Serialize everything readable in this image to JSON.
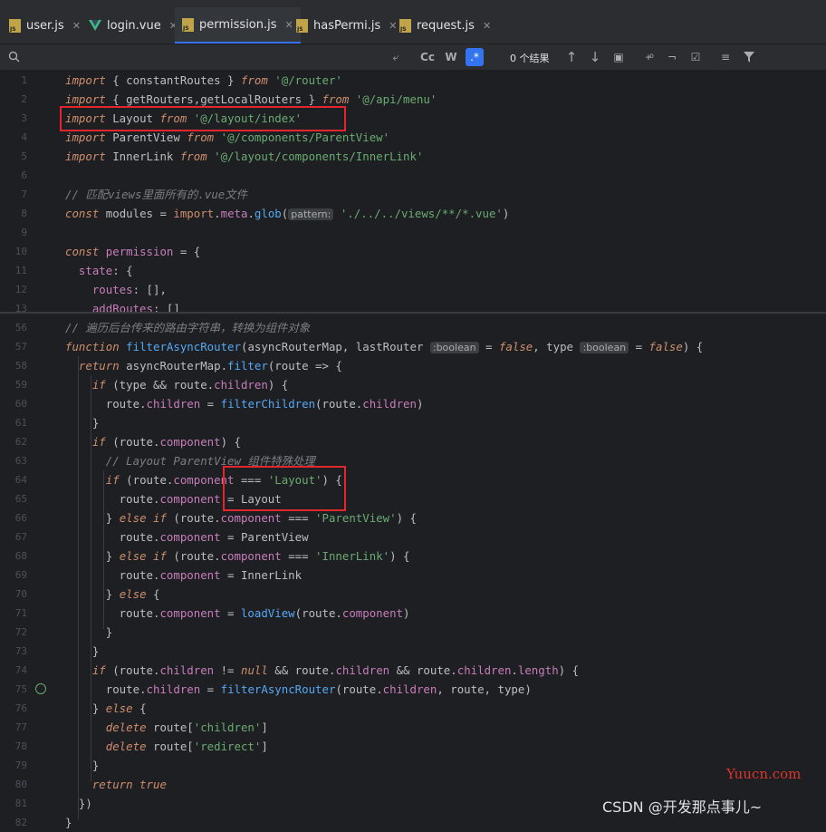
{
  "tabs": [
    {
      "label": "user.js",
      "icon": "js-file-icon"
    },
    {
      "label": "login.vue",
      "icon": "vue-file-icon"
    },
    {
      "label": "permission.js",
      "icon": "js-file-icon",
      "active": true
    },
    {
      "label": "hasPermi.js",
      "icon": "js-file-icon"
    },
    {
      "label": "request.js",
      "icon": "js-file-icon"
    }
  ],
  "search": {
    "match_case": "Cc",
    "words": "W",
    "regex": ".*",
    "results": "0 个结果"
  },
  "sticky_lines": [
    {
      "n": "1",
      "segs": [
        [
          "kwi",
          "import"
        ],
        [
          "t",
          " { constantRoutes } "
        ],
        [
          "kwi",
          "from"
        ],
        [
          "t",
          " "
        ],
        [
          "str",
          "'@/router'"
        ]
      ]
    },
    {
      "n": "2",
      "segs": [
        [
          "kwi",
          "import"
        ],
        [
          "t",
          " { getRouters,getLocalRouters } "
        ],
        [
          "kwi",
          "from"
        ],
        [
          "t",
          " "
        ],
        [
          "str",
          "'@/api/menu'"
        ]
      ]
    },
    {
      "n": "3",
      "segs": [
        [
          "kwi",
          "import"
        ],
        [
          "t",
          " Layout "
        ],
        [
          "kwi",
          "from"
        ],
        [
          "t",
          " "
        ],
        [
          "str",
          "'@/layout/index'"
        ]
      ]
    },
    {
      "n": "4",
      "segs": [
        [
          "kwi",
          "import"
        ],
        [
          "t",
          " ParentView "
        ],
        [
          "kwi",
          "from"
        ],
        [
          "t",
          " "
        ],
        [
          "str",
          "'@/components/ParentView'"
        ]
      ]
    },
    {
      "n": "5",
      "segs": [
        [
          "kwi",
          "import"
        ],
        [
          "t",
          " InnerLink "
        ],
        [
          "kwi",
          "from"
        ],
        [
          "t",
          " "
        ],
        [
          "str",
          "'@/layout/components/InnerLink'"
        ]
      ]
    },
    {
      "n": "6",
      "segs": []
    },
    {
      "n": "7",
      "segs": [
        [
          "cm",
          "// 匹配views里面所有的.vue文件"
        ]
      ]
    },
    {
      "n": "8",
      "segs": [
        [
          "kwi",
          "const"
        ],
        [
          "t",
          " modules = "
        ],
        [
          "kw",
          "import"
        ],
        [
          "t",
          "."
        ],
        [
          "prop",
          "meta"
        ],
        [
          "t",
          "."
        ],
        [
          "fn",
          "glob"
        ],
        [
          "t",
          "("
        ],
        [
          "hint",
          "pattern:"
        ],
        [
          "t",
          " "
        ],
        [
          "str",
          "'./../../views/**/*.vue'"
        ],
        [
          "t",
          ")"
        ]
      ]
    },
    {
      "n": "9",
      "segs": []
    },
    {
      "n": "10",
      "segs": [
        [
          "kwi",
          "const"
        ],
        [
          "prop",
          " permission"
        ],
        [
          "t",
          " = {"
        ]
      ]
    },
    {
      "n": "11",
      "segs": [
        [
          "t",
          "  "
        ],
        [
          "prop",
          "state"
        ],
        [
          "t",
          ": {"
        ]
      ]
    },
    {
      "n": "12",
      "segs": [
        [
          "t",
          "    "
        ],
        [
          "prop",
          "routes"
        ],
        [
          "t",
          ": [],"
        ]
      ]
    },
    {
      "n": "13",
      "segs": [
        [
          "t",
          "    "
        ],
        [
          "prop",
          "addRoutes"
        ],
        [
          "t",
          ": []"
        ]
      ]
    }
  ],
  "code_lines": [
    {
      "n": "56",
      "segs": [
        [
          "cm",
          "// 遍历后台传来的路由字符串，转换为组件对象"
        ]
      ]
    },
    {
      "n": "57",
      "segs": [
        [
          "kwi",
          "function"
        ],
        [
          "t",
          " "
        ],
        [
          "fn",
          "filterAsyncRouter"
        ],
        [
          "t",
          "(asyncRouterMap, lastRouter "
        ],
        [
          "hint",
          ":boolean"
        ],
        [
          "t",
          " = "
        ],
        [
          "kwi",
          "false"
        ],
        [
          "t",
          ", type "
        ],
        [
          "hint",
          ":boolean"
        ],
        [
          "t",
          " = "
        ],
        [
          "kwi",
          "false"
        ],
        [
          "t",
          ") {"
        ]
      ]
    },
    {
      "n": "58",
      "segs": [
        [
          "t",
          "  "
        ],
        [
          "kwi",
          "return"
        ],
        [
          "t",
          " asyncRouterMap."
        ],
        [
          "fn",
          "filter"
        ],
        [
          "t",
          "(route => {"
        ]
      ]
    },
    {
      "n": "59",
      "segs": [
        [
          "t",
          "    "
        ],
        [
          "kwi",
          "if"
        ],
        [
          "t",
          " (type && route."
        ],
        [
          "prop",
          "children"
        ],
        [
          "t",
          ") {"
        ]
      ]
    },
    {
      "n": "60",
      "segs": [
        [
          "t",
          "      route."
        ],
        [
          "prop",
          "children"
        ],
        [
          "t",
          " = "
        ],
        [
          "fn",
          "filterChildren"
        ],
        [
          "t",
          "(route."
        ],
        [
          "prop",
          "children"
        ],
        [
          "t",
          ")"
        ]
      ]
    },
    {
      "n": "61",
      "segs": [
        [
          "t",
          "    }"
        ]
      ]
    },
    {
      "n": "62",
      "segs": [
        [
          "t",
          "    "
        ],
        [
          "kwi",
          "if"
        ],
        [
          "t",
          " (route."
        ],
        [
          "prop",
          "component"
        ],
        [
          "t",
          ") {"
        ]
      ]
    },
    {
      "n": "63",
      "segs": [
        [
          "t",
          "      "
        ],
        [
          "cm",
          "// Layout ParentView 组件特殊处理"
        ]
      ]
    },
    {
      "n": "64",
      "segs": [
        [
          "t",
          "      "
        ],
        [
          "kwi",
          "if"
        ],
        [
          "t",
          " (route."
        ],
        [
          "prop",
          "component"
        ],
        [
          "t",
          " === "
        ],
        [
          "str",
          "'Layout'"
        ],
        [
          "t",
          ") {"
        ]
      ]
    },
    {
      "n": "65",
      "segs": [
        [
          "t",
          "        route."
        ],
        [
          "prop",
          "component"
        ],
        [
          "t",
          " = Layout"
        ]
      ]
    },
    {
      "n": "66",
      "segs": [
        [
          "t",
          "      } "
        ],
        [
          "kwi",
          "else if"
        ],
        [
          "t",
          " (route."
        ],
        [
          "prop",
          "component"
        ],
        [
          "t",
          " === "
        ],
        [
          "str",
          "'ParentView'"
        ],
        [
          "t",
          ") {"
        ]
      ]
    },
    {
      "n": "67",
      "segs": [
        [
          "t",
          "        route."
        ],
        [
          "prop",
          "component"
        ],
        [
          "t",
          " = ParentView"
        ]
      ]
    },
    {
      "n": "68",
      "segs": [
        [
          "t",
          "      } "
        ],
        [
          "kwi",
          "else if"
        ],
        [
          "t",
          " (route."
        ],
        [
          "prop",
          "component"
        ],
        [
          "t",
          " === "
        ],
        [
          "str",
          "'InnerLink'"
        ],
        [
          "t",
          ") {"
        ]
      ]
    },
    {
      "n": "69",
      "segs": [
        [
          "t",
          "        route."
        ],
        [
          "prop",
          "component"
        ],
        [
          "t",
          " = InnerLink"
        ]
      ]
    },
    {
      "n": "70",
      "segs": [
        [
          "t",
          "      } "
        ],
        [
          "kwi",
          "else"
        ],
        [
          "t",
          " {"
        ]
      ]
    },
    {
      "n": "71",
      "segs": [
        [
          "t",
          "        route."
        ],
        [
          "prop",
          "component"
        ],
        [
          "t",
          " = "
        ],
        [
          "fn",
          "loadView"
        ],
        [
          "t",
          "(route."
        ],
        [
          "prop",
          "component"
        ],
        [
          "t",
          ")"
        ]
      ]
    },
    {
      "n": "72",
      "segs": [
        [
          "t",
          "      }"
        ]
      ]
    },
    {
      "n": "73",
      "segs": [
        [
          "t",
          "    }"
        ]
      ]
    },
    {
      "n": "74",
      "segs": [
        [
          "t",
          "    "
        ],
        [
          "kwi",
          "if"
        ],
        [
          "t",
          " (route."
        ],
        [
          "prop",
          "children"
        ],
        [
          "t",
          " != "
        ],
        [
          "kwi",
          "null"
        ],
        [
          "t",
          " && route."
        ],
        [
          "prop",
          "children"
        ],
        [
          "t",
          " && route."
        ],
        [
          "prop",
          "children"
        ],
        [
          "t",
          "."
        ],
        [
          "prop",
          "length"
        ],
        [
          "t",
          ") {"
        ]
      ]
    },
    {
      "n": "75",
      "segs": [
        [
          "t",
          "      route."
        ],
        [
          "prop",
          "children"
        ],
        [
          "t",
          " = "
        ],
        [
          "fn",
          "filterAsyncRouter"
        ],
        [
          "t",
          "(route."
        ],
        [
          "prop",
          "children"
        ],
        [
          "t",
          ", route, type)"
        ]
      ]
    },
    {
      "n": "76",
      "segs": [
        [
          "t",
          "    } "
        ],
        [
          "kwi",
          "else"
        ],
        [
          "t",
          " {"
        ]
      ]
    },
    {
      "n": "77",
      "segs": [
        [
          "t",
          "      "
        ],
        [
          "kwi",
          "delete"
        ],
        [
          "t",
          " route["
        ],
        [
          "str",
          "'children'"
        ],
        [
          "t",
          "]"
        ]
      ]
    },
    {
      "n": "78",
      "segs": [
        [
          "t",
          "      "
        ],
        [
          "kwi",
          "delete"
        ],
        [
          "t",
          " route["
        ],
        [
          "str",
          "'redirect'"
        ],
        [
          "t",
          "]"
        ]
      ]
    },
    {
      "n": "79",
      "segs": [
        [
          "t",
          "    }"
        ]
      ]
    },
    {
      "n": "80",
      "segs": [
        [
          "t",
          "    "
        ],
        [
          "kwi",
          "return true"
        ]
      ]
    },
    {
      "n": "81",
      "segs": [
        [
          "t",
          "  })"
        ]
      ]
    },
    {
      "n": "82",
      "segs": [
        [
          "t",
          "}"
        ]
      ]
    }
  ],
  "watermarks": {
    "site": "Yuucn.com",
    "author": "CSDN @开发那点事儿~"
  }
}
